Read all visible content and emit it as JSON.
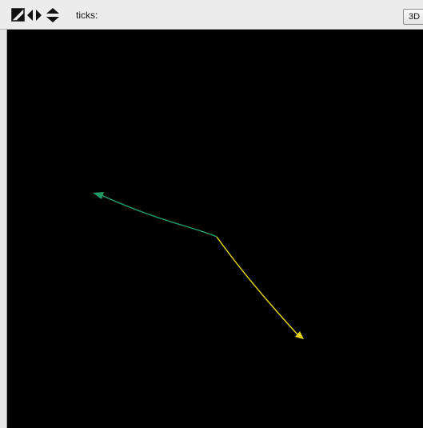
{
  "toolbar": {
    "icons": [
      "reset-view-icon",
      "pan-horizontal-icon",
      "pan-vertical-icon"
    ],
    "ticks_label": "ticks:",
    "view_mode_button": "3D"
  },
  "viewport": {
    "background": "#000000",
    "vectors": [
      {
        "name": "green",
        "color": "#1f9a66"
      },
      {
        "name": "yellow",
        "color": "#e3d21a"
      }
    ]
  }
}
